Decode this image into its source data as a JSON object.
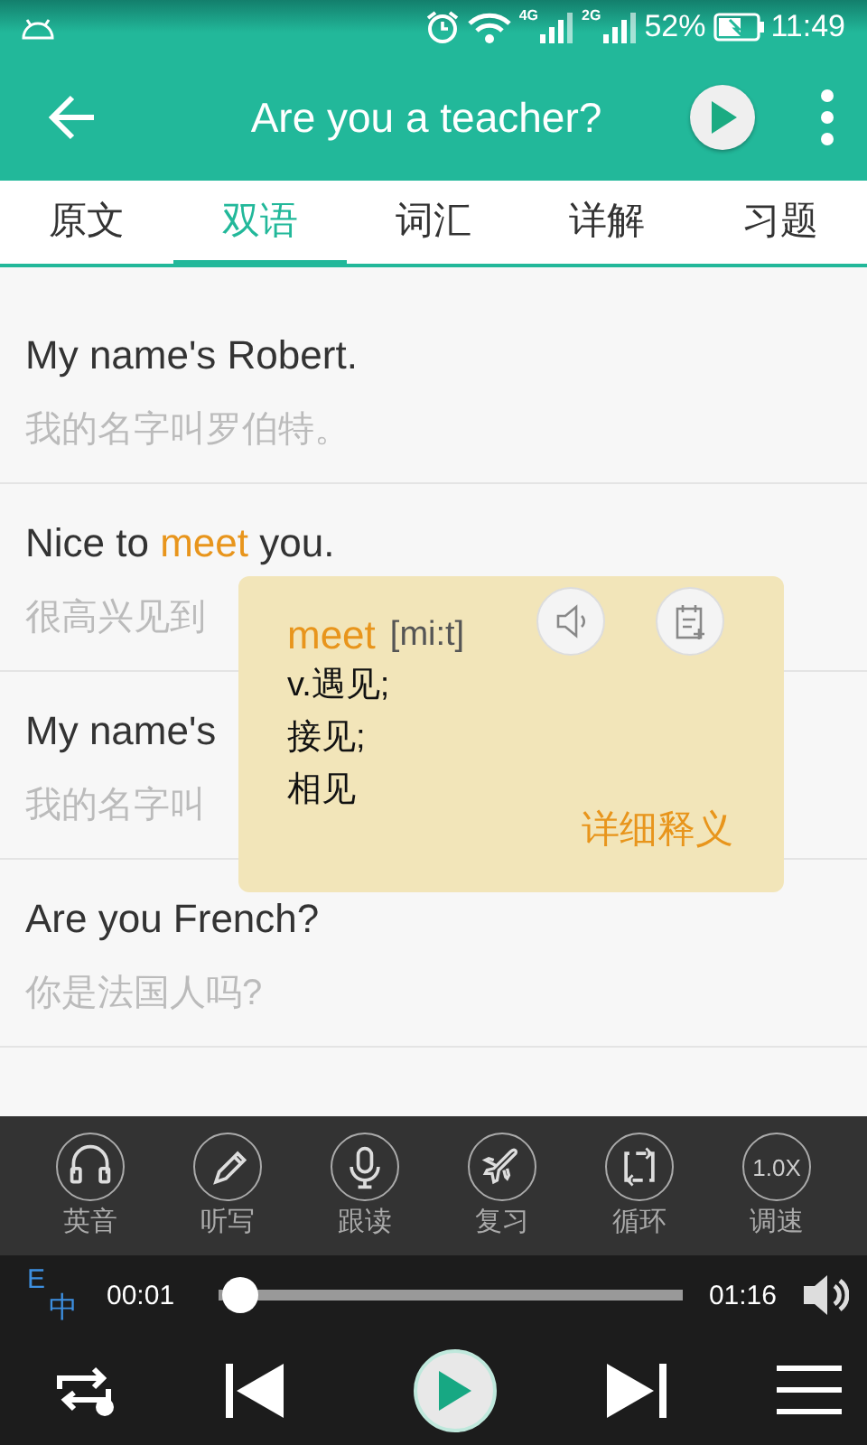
{
  "status_bar": {
    "network_labels": [
      "4G",
      "2G"
    ],
    "battery": "52%",
    "time": "11:49"
  },
  "toolbar": {
    "title": "Are you a teacher?"
  },
  "tabs": [
    {
      "label": "原文",
      "selected": false
    },
    {
      "label": "双语",
      "selected": true
    },
    {
      "label": "词汇",
      "selected": false
    },
    {
      "label": "详解",
      "selected": false
    },
    {
      "label": "习题",
      "selected": false
    }
  ],
  "sentences": [
    {
      "english": [
        {
          "text": "My name's Robert.",
          "highlighted": false
        }
      ],
      "chinese": "我的名字叫罗伯特。"
    },
    {
      "english": [
        {
          "text": "Nice to ",
          "highlighted": false
        },
        {
          "text": "meet",
          "highlighted": true
        },
        {
          "text": " you.",
          "highlighted": false
        }
      ],
      "chinese": "很高兴见到"
    },
    {
      "english": [
        {
          "text": "My name's",
          "highlighted": false
        }
      ],
      "chinese": "我的名字叫"
    },
    {
      "english": [
        {
          "text": "Are you French?",
          "highlighted": false
        }
      ],
      "chinese": "你是法国人吗?"
    }
  ],
  "word_popup": {
    "word": "meet",
    "phonetic": "[mi:t]",
    "meanings": [
      "v.遇见;",
      "接见;",
      "相见"
    ],
    "more_link": "详细释义"
  },
  "tools": [
    {
      "kind": "headphones",
      "label": "英音"
    },
    {
      "kind": "pencil",
      "label": "听写"
    },
    {
      "kind": "mic",
      "label": "跟读"
    },
    {
      "kind": "plane",
      "label": "复习"
    },
    {
      "kind": "loop",
      "label": "循环"
    },
    {
      "kind": "speed",
      "label": "调速",
      "badge": "1.0X"
    }
  ],
  "player": {
    "lang_toggle": {
      "top": "E",
      "bottom": "中"
    },
    "elapsed": "00:01",
    "total": "01:16",
    "level": 0.01
  }
}
